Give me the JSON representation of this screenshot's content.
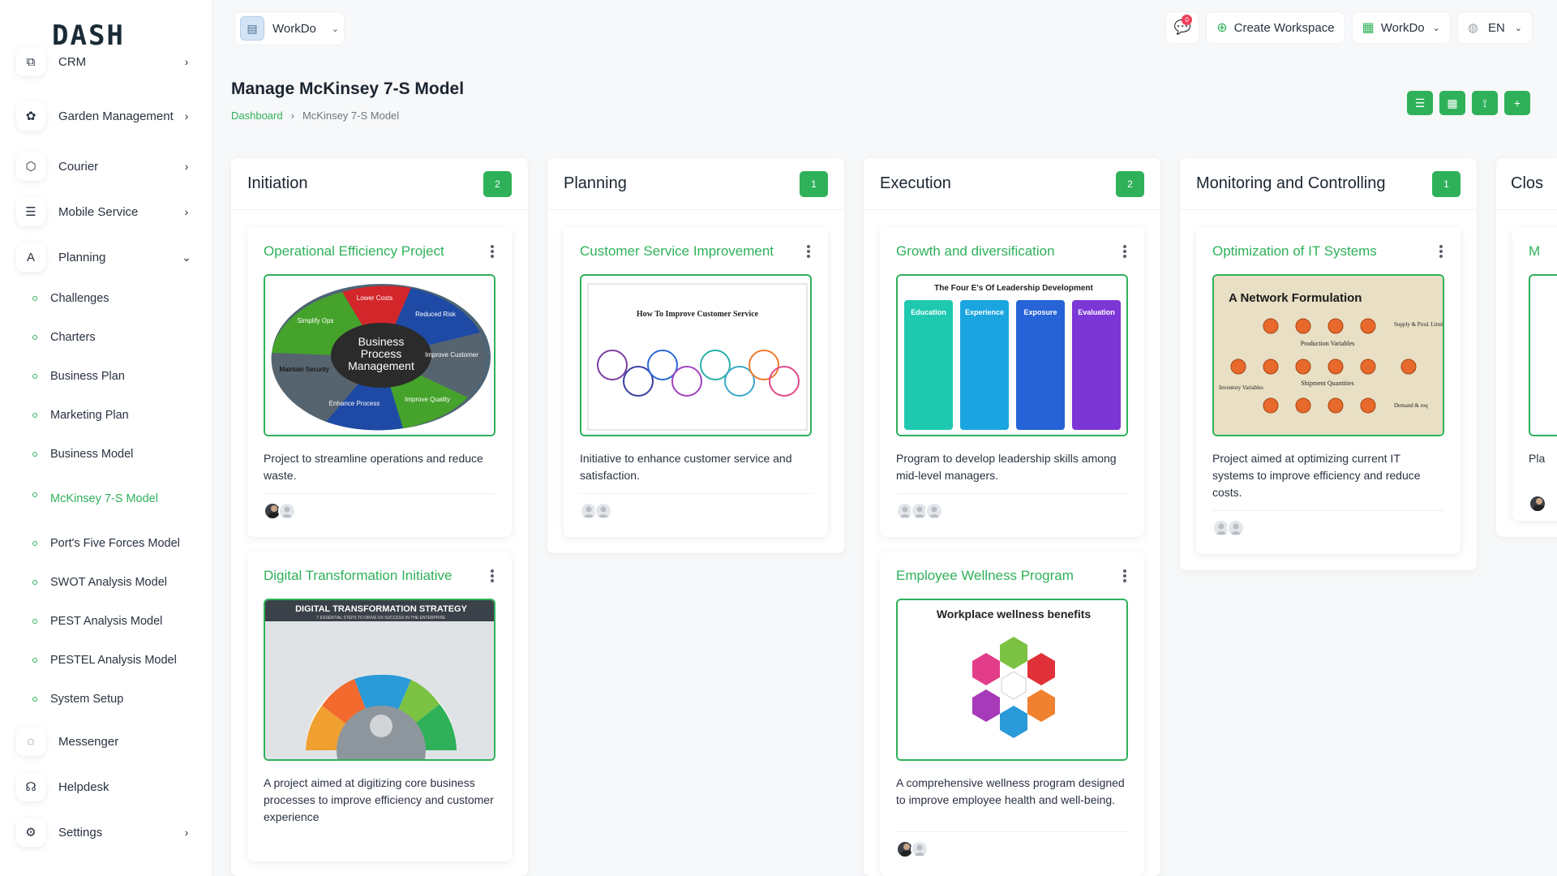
{
  "brand": {
    "logo": "DASH"
  },
  "sidebar": {
    "items": [
      {
        "label": "CRM",
        "icon": "crm-icon"
      },
      {
        "label": "Garden Management",
        "icon": "garden-icon"
      },
      {
        "label": "Courier",
        "icon": "box-icon"
      },
      {
        "label": "Mobile Service",
        "icon": "list-icon"
      },
      {
        "label": "Planning",
        "icon": "planning-icon"
      },
      {
        "label": "Messenger",
        "icon": "chat-icon"
      },
      {
        "label": "Helpdesk",
        "icon": "headset-icon"
      },
      {
        "label": "Settings",
        "icon": "gear-icon"
      }
    ],
    "sub_items": [
      "Challenges",
      "Charters",
      "Business Plan",
      "Marketing Plan",
      "Business Model",
      "McKinsey 7-S Model",
      "Port's Five Forces Model",
      "SWOT Analysis Model",
      "PEST Analysis Model",
      "PESTEL Analysis Model",
      "System Setup"
    ]
  },
  "topbar": {
    "workspace": "WorkDo",
    "notification_count": "0",
    "create_workspace": "Create Workspace",
    "workspace_switch": "WorkDo",
    "language": "EN"
  },
  "page": {
    "title": "Manage McKinsey 7-S Model",
    "breadcrumb": {
      "home": "Dashboard",
      "current": "McKinsey 7-S Model"
    }
  },
  "columns": [
    {
      "title": "Initiation",
      "count": "2",
      "cards": [
        {
          "title": "Operational Efficiency Project",
          "desc": "Project to streamline operations and reduce waste.",
          "image": {
            "center": "Business Process Management",
            "segments": [
              "Lower Costs",
              "Reduced Risk",
              "Improve Customer Satisfaction",
              "Improve Quality",
              "Enhance Process Consistency",
              "Maintain Security",
              "Simplify Operations"
            ]
          }
        },
        {
          "title": "Digital Transformation Initiative",
          "desc": "A project aimed at digitizing core business processes to improve efficiency and customer experience",
          "image": {
            "heading": "DIGITAL TRANSFORMATION STRATEGY",
            "subheading": "7 ESSENTIAL STEPS TO DRIVE DX SUCCESS IN THE ENTERPRISE"
          }
        }
      ]
    },
    {
      "title": "Planning",
      "count": "1",
      "cards": [
        {
          "title": "Customer Service Improvement",
          "desc": "Initiative to enhance customer service and satisfaction.",
          "image": {
            "heading": "How To Improve Customer Service"
          }
        }
      ]
    },
    {
      "title": "Execution",
      "count": "2",
      "cards": [
        {
          "title": "Growth and diversification",
          "desc": "Program to develop leadership skills among mid-level managers.",
          "image": {
            "heading": "The Four E's Of Leadership Development",
            "columns": [
              "Education",
              "Experience",
              "Exposure",
              "Evaluation"
            ]
          }
        },
        {
          "title": "Employee Wellness Program",
          "desc": "A comprehensive wellness program designed to improve employee health and well-being.",
          "image": {
            "heading": "Workplace wellness benefits"
          }
        }
      ]
    },
    {
      "title": "Monitoring and Controlling",
      "count": "1",
      "cards": [
        {
          "title": "Optimization of IT Systems",
          "desc": "Project aimed at optimizing current IT systems to improve efficiency and reduce costs.",
          "image": {
            "heading": "A Network Formulation",
            "labels": [
              "Production Variables",
              "Shipment Quantities",
              "Inventory Variables",
              "Supply & Prod. Limits",
              "Demand & req"
            ]
          }
        }
      ]
    },
    {
      "title": "Clos",
      "count": "",
      "cards": [
        {
          "title": "M",
          "desc": "Pla",
          "image": {}
        }
      ]
    }
  ],
  "colors": {
    "accent": "#2fb15a"
  }
}
